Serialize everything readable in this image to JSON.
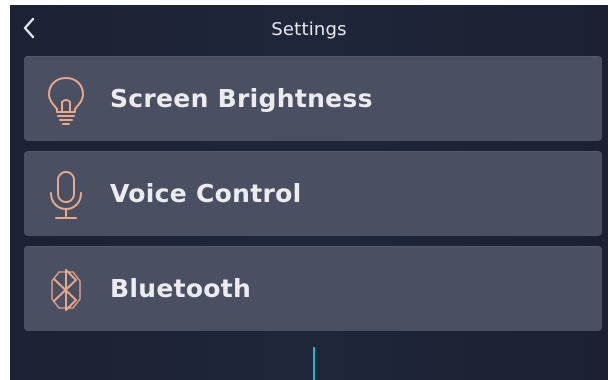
{
  "header": {
    "title": "Settings",
    "back_icon": "chevron-left-icon"
  },
  "menu": {
    "items": [
      {
        "label": "Screen Brightness",
        "icon": "lightbulb-icon"
      },
      {
        "label": "Voice Control",
        "icon": "microphone-icon"
      },
      {
        "label": "Bluetooth",
        "icon": "bluetooth-icon"
      }
    ]
  },
  "colors": {
    "background": "#1e2436",
    "item_background": "#4a4f62",
    "item_text": "#ececf0",
    "icon_accent": "#e7a98c",
    "indicator": "#25b6c3"
  }
}
